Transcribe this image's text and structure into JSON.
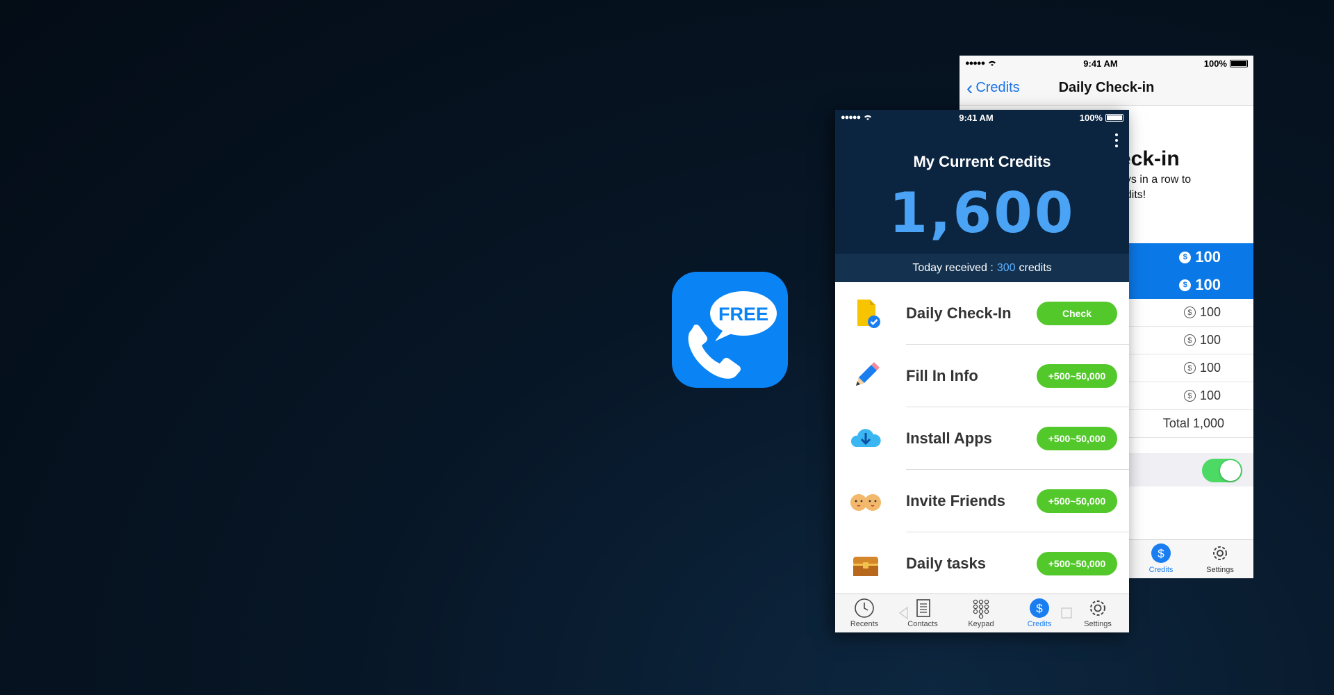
{
  "app_icon": {
    "text": "FREE",
    "color": "#0a84f5"
  },
  "back_screen": {
    "status": {
      "time": "9:41 AM",
      "battery": "100%"
    },
    "nav": {
      "back_label": "Credits",
      "title": "Daily Check-in"
    },
    "heading": "eck-in",
    "subtext_line1": "ays in a row to",
    "subtext_line2": "edits!",
    "rewards": [
      {
        "coin": "$",
        "amount": "100",
        "active": true
      },
      {
        "coin": "$",
        "amount": "100",
        "active": true
      },
      {
        "coin": "$",
        "amount": "100",
        "active": false
      },
      {
        "coin": "$",
        "amount": "100",
        "active": false
      },
      {
        "coin": "$",
        "amount": "100",
        "active": false
      },
      {
        "coin": "$",
        "amount": "100",
        "active": false
      }
    ],
    "total": "Total 1,000",
    "toggle_on": true,
    "tabs": [
      {
        "label": "Credits",
        "icon": "dollar-icon",
        "active": true
      },
      {
        "label": "Settings",
        "icon": "gear-icon",
        "active": false
      }
    ]
  },
  "front_screen": {
    "status": {
      "time": "9:41 AM",
      "battery": "100%"
    },
    "title": "My Current Credits",
    "credits": "1,600",
    "today": {
      "prefix": "Today received :",
      "value": "300",
      "suffix": "credits"
    },
    "tasks": [
      {
        "label": "Daily Check-In",
        "button": "Check",
        "icon": "calendar-check-icon"
      },
      {
        "label": "Fill In Info",
        "button": "+500~50,000",
        "icon": "pencil-icon"
      },
      {
        "label": "Install Apps",
        "button": "+500~50,000",
        "icon": "cloud-download-icon"
      },
      {
        "label": "Invite Friends",
        "button": "+500~50,000",
        "icon": "friends-icon"
      },
      {
        "label": "Daily tasks",
        "button": "+500~50,000",
        "icon": "treasure-chest-icon"
      }
    ],
    "tabs": [
      {
        "label": "Recents",
        "icon": "clock-icon",
        "active": false
      },
      {
        "label": "Contacts",
        "icon": "contacts-book-icon",
        "active": false
      },
      {
        "label": "Keypad",
        "icon": "keypad-icon",
        "active": false
      },
      {
        "label": "Credits",
        "icon": "dollar-icon",
        "active": true
      },
      {
        "label": "Settings",
        "icon": "gear-icon",
        "active": false
      }
    ]
  },
  "colors": {
    "accent_blue": "#0b78e8",
    "header_navy": "#0b2540",
    "credit_blue": "#4ba3f5",
    "button_green": "#53c82b",
    "toggle_green": "#4cd964"
  }
}
